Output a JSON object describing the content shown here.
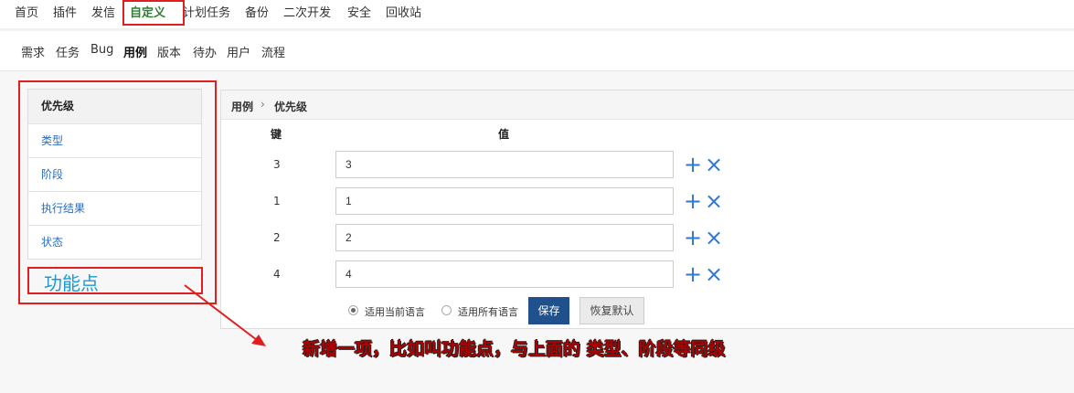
{
  "top_nav": [
    "首页",
    "插件",
    "发信",
    "自定义",
    "计划任务",
    "备份",
    "二次开发",
    "安全",
    "回收站"
  ],
  "sub_nav": [
    "需求",
    "任务",
    "Bug",
    "用例",
    "版本",
    "待办",
    "用户",
    "流程"
  ],
  "side_menu": [
    "优先级",
    "类型",
    "阶段",
    "执行结果",
    "状态"
  ],
  "breadcrumb": {
    "parent": "用例",
    "separator": "›",
    "current": "优先级"
  },
  "table": {
    "key_header": "键",
    "value_header": "值",
    "rows": [
      {
        "key": "3",
        "value": "3"
      },
      {
        "key": "1",
        "value": "1"
      },
      {
        "key": "2",
        "value": "2"
      },
      {
        "key": "4",
        "value": "4"
      }
    ]
  },
  "icons": {
    "add": "plus-icon",
    "remove": "close-icon",
    "add_glyph": "+",
    "remove_glyph": "×"
  },
  "options": {
    "current_lang": "适用当前语言",
    "all_lang": "适用所有语言"
  },
  "buttons": {
    "save": "保存",
    "reset": "恢复默认"
  },
  "annotations": {
    "feature_label": "功能点",
    "note": "新增一项，比如叫功能点，与上面的 类型、阶段等同级"
  },
  "colors": {
    "annotation_red": "#e02020",
    "active_nav": "#2e7d32",
    "save_button": "#20518c",
    "link_blue": "#2a6ebb",
    "icon_blue": "#2f77d6"
  }
}
